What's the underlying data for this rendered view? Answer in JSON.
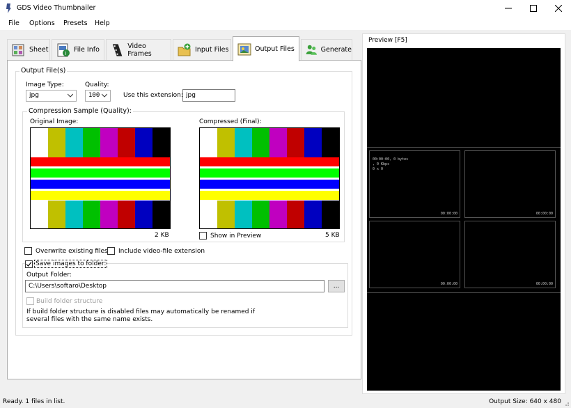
{
  "window": {
    "title": "GDS Video Thumbnailer"
  },
  "menu": [
    "File",
    "Options",
    "Presets",
    "Help"
  ],
  "tabs": [
    {
      "label": "Sheet",
      "icon": "sheet-icon"
    },
    {
      "label": "File Info",
      "icon": "file-info-icon"
    },
    {
      "label": "Video Frames",
      "icon": "film-icon"
    },
    {
      "label": "Input Files",
      "icon": "folder-plus-icon"
    },
    {
      "label": "Output Files",
      "icon": "picture-icon",
      "active": true
    },
    {
      "label": "Generate",
      "icon": "people-icon"
    }
  ],
  "output_files": {
    "group_title": "Output File(s)",
    "image_type_label": "Image Type:",
    "image_type_value": "jpg",
    "quality_label": "Quality:",
    "quality_value": "100",
    "extension_label": "Use this extension:",
    "extension_value": "jpg",
    "compression_title": "Compression Sample (Quality):",
    "original_label": "Original Image:",
    "compressed_label": "Compressed (Final):",
    "original_size": "2 KB",
    "compressed_size": "5 KB",
    "show_in_preview": {
      "label": "Show in Preview",
      "checked": false
    },
    "overwrite": {
      "label": "Overwrite existing files",
      "checked": false
    },
    "include_ext": {
      "label": "Include video-file extension",
      "checked": false
    },
    "save_to_folder": {
      "label": "Save images to folder:",
      "checked": true
    },
    "output_folder_label": "Output Folder:",
    "output_folder_value": "C:\\Users\\softaro\\Desktop",
    "browse_label": "...",
    "build_structure": {
      "label": "Build folder structure",
      "checked": false,
      "disabled": true
    },
    "note_line1": "If build folder structure is disabled files may automatically be renamed if",
    "note_line2": "several files with the same name exists."
  },
  "colors": {
    "bars": [
      "#ffffff",
      "#c0c000",
      "#00c0c0",
      "#00c000",
      "#c000c0",
      "#c00000",
      "#0000c0",
      "#000000"
    ],
    "stripes": [
      "#ff0000",
      "#00ff00",
      "#0000ff",
      "#ffff00"
    ]
  },
  "preview": {
    "title": "Preview  [F5]",
    "info_line1": "00:00:00, 0 bytes",
    "info_line2": ", 0 Kbps",
    "info_line3": "0 x 0",
    "timestamps": [
      "00:00:00",
      "00:00:00",
      "00:00:00",
      "00:00:00"
    ]
  },
  "status": {
    "left": "Ready. 1 files in list.",
    "right": "Output Size: 640 x 480"
  }
}
